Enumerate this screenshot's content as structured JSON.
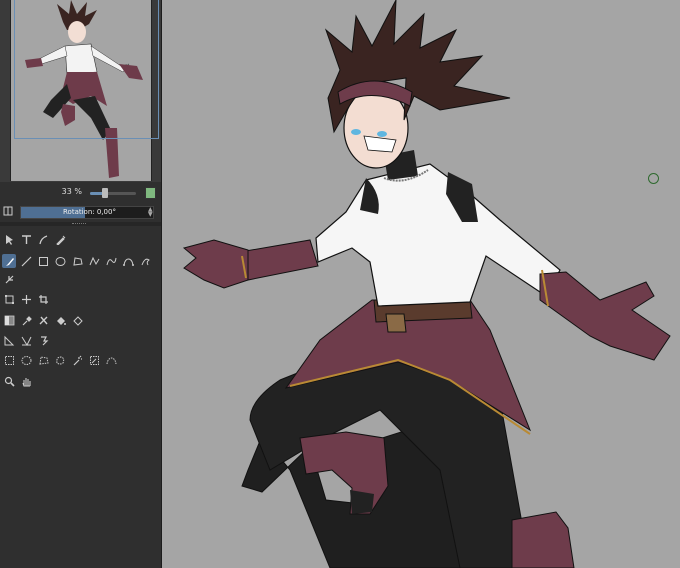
{
  "navigator": {
    "zoom_label": "33 %",
    "zoom_level_percent": 33
  },
  "rotation": {
    "label": "Rotation: 0,00°",
    "value_degrees": 0
  },
  "toolbox": {
    "rows": [
      [
        "select-icon",
        "text-icon",
        "calligraphy-icon",
        "fill-pen-icon"
      ],
      [
        "brush-icon",
        "line-icon",
        "rectangle-icon",
        "ellipse-icon",
        "polygon-icon",
        "polyline-icon",
        "freehand-path-icon",
        "bezier-icon",
        "dynamic-brush-icon"
      ],
      [
        "multibrush-icon"
      ],
      [
        "transform-icon",
        "move-icon",
        "crop-icon"
      ],
      [
        "gradient-icon",
        "color-picker-icon",
        "smart-patch-icon",
        "fill-icon",
        "enclosed-fill-icon"
      ],
      [
        "measure-icon",
        "assistant-icon",
        "reference-icon"
      ],
      [
        "rect-select-icon",
        "ellipse-select-icon",
        "polygon-select-icon",
        "freehand-select-icon",
        "contiguous-select-icon",
        "similar-select-icon",
        "bezier-select-icon"
      ],
      [
        "zoom-icon",
        "pan-icon"
      ]
    ],
    "active_tool": "brush-icon"
  },
  "colors": {
    "panel_bg": "#2f2f2f",
    "canvas_bg": "#a5a5a5",
    "accent": "#4f6f93"
  }
}
